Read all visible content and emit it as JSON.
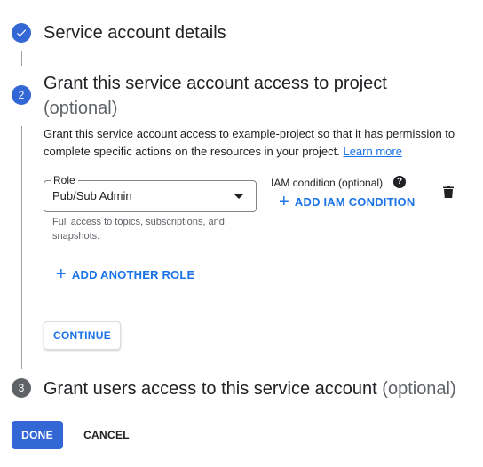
{
  "steps": [
    {
      "status": "complete",
      "icon": "check-icon",
      "title": "Service account details"
    },
    {
      "status": "active",
      "number": "2",
      "title": "Grant this service account access to project",
      "optional": "(optional)"
    },
    {
      "status": "pending",
      "number": "3",
      "title": "Grant users access to this service account",
      "optional": "(optional)"
    }
  ],
  "grant": {
    "description": "Grant this service account access to example-project so that it has permission to complete specific actions on the resources in your project.",
    "learn_more": "Learn more",
    "role": {
      "label": "Role",
      "value": "Pub/Sub Admin",
      "helper": "Full access to topics, subscriptions, and snapshots."
    },
    "iam_condition_label": "IAM condition (optional)",
    "help_icon": "?",
    "add_iam_condition": "ADD IAM CONDITION",
    "add_another_role": "ADD ANOTHER ROLE",
    "continue": "CONTINUE"
  },
  "footer": {
    "done": "DONE",
    "cancel": "CANCEL"
  },
  "colors": {
    "primary": "#3367d6",
    "link": "#1a73e8",
    "text": "#202124",
    "secondary_text": "#5f6368"
  }
}
